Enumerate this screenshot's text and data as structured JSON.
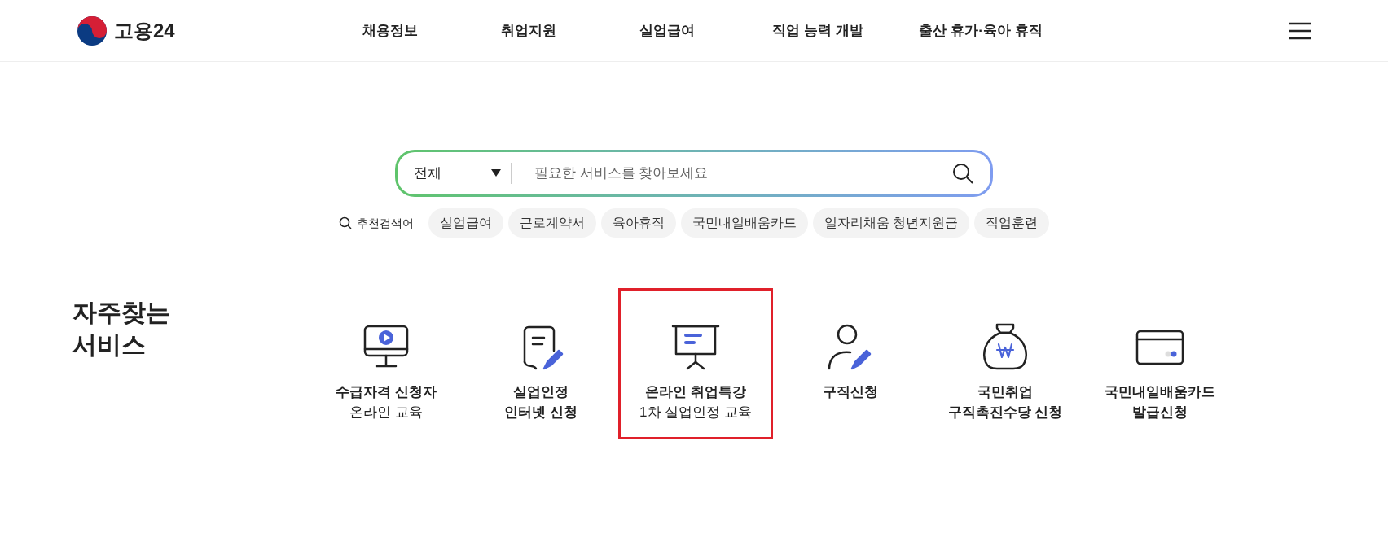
{
  "header": {
    "logo": "고용24",
    "nav": [
      "채용정보",
      "취업지원",
      "실업급여",
      "직업 능력 개발",
      "출산 휴가·육아 휴직"
    ]
  },
  "search": {
    "category": "전체",
    "placeholder": "필요한 서비스를 찾아보세요",
    "recommend_label": "추천검색어",
    "keywords": [
      "실업급여",
      "근로계약서",
      "육아휴직",
      "국민내일배움카드",
      "일자리채움 청년지원금",
      "직업훈련"
    ]
  },
  "services": {
    "title": "자주찾는\n서비스",
    "items": [
      {
        "highlighted": false,
        "lines": [
          {
            "text": "수급자격 신청자",
            "bold": true
          },
          {
            "text": "온라인 교육",
            "bold": false
          }
        ]
      },
      {
        "highlighted": false,
        "lines": [
          {
            "text": "실업인정",
            "bold": true
          },
          {
            "text": "인터넷 신청",
            "bold": true
          }
        ]
      },
      {
        "highlighted": true,
        "lines": [
          {
            "text": "온라인 취업특강",
            "bold": true
          },
          {
            "text": "1차 실업인정 교육",
            "bold": false
          }
        ]
      },
      {
        "highlighted": false,
        "lines": [
          {
            "text": "구직신청",
            "bold": true
          }
        ]
      },
      {
        "highlighted": false,
        "lines": [
          {
            "text": "국민취업",
            "bold": true
          },
          {
            "text": "구직촉진수당 신청",
            "bold": true
          }
        ]
      },
      {
        "highlighted": false,
        "lines": [
          {
            "text": "국민내일배움카드",
            "bold": true
          },
          {
            "text": "발급신청",
            "bold": true
          }
        ]
      }
    ]
  }
}
